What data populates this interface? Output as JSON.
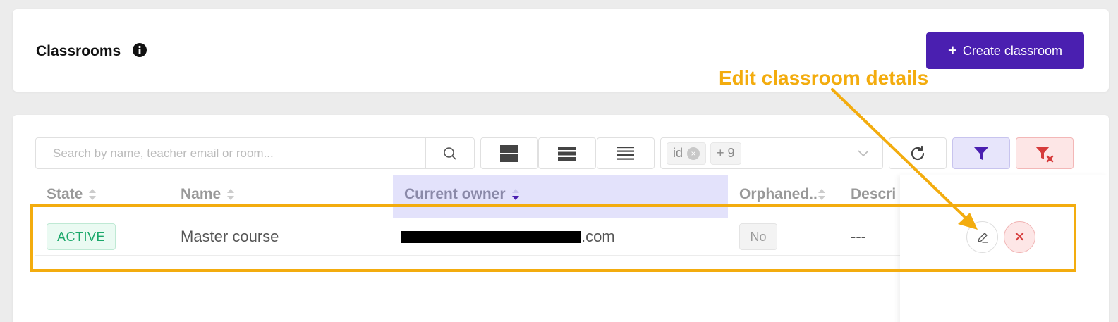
{
  "header": {
    "title": "Classrooms",
    "create_button_label": "Create classroom"
  },
  "toolbar": {
    "search_placeholder": "Search by name, teacher email or room...",
    "search_value": "",
    "filter_tags": [
      {
        "label": "id"
      },
      {
        "label": "+ 9"
      }
    ]
  },
  "table": {
    "columns": [
      {
        "label": "State",
        "sorted": false
      },
      {
        "label": "Name",
        "sorted": false
      },
      {
        "label": "Current owner",
        "sorted": true
      },
      {
        "label": "Orphaned..",
        "sorted": false
      },
      {
        "label": "Descri",
        "sorted": false
      }
    ],
    "rows": [
      {
        "state": "ACTIVE",
        "name": "Master course",
        "owner_visible_suffix": ".com",
        "orphaned": "No",
        "description": "---"
      }
    ]
  },
  "annotation": {
    "text": "Edit classroom details",
    "color": "#f3ac0e"
  },
  "colors": {
    "primary": "#4a1fb0",
    "active_green": "#1aa86a",
    "danger": "#d63b3b"
  }
}
